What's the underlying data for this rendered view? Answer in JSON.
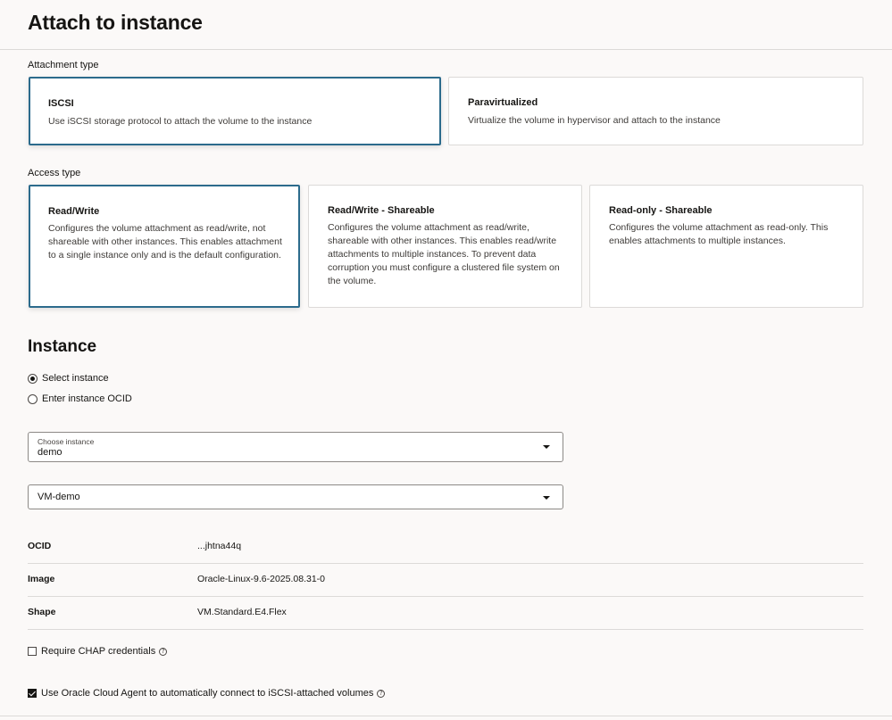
{
  "page": {
    "title": "Attach to instance"
  },
  "attachment_type": {
    "label": "Attachment type",
    "selected_index": 0,
    "options": [
      {
        "title": "ISCSI",
        "description": "Use iSCSI storage protocol to attach the volume to the instance"
      },
      {
        "title": "Paravirtualized",
        "description": "Virtualize the volume in hypervisor and attach to the instance"
      }
    ]
  },
  "access_type": {
    "label": "Access type",
    "selected_index": 0,
    "options": [
      {
        "title": "Read/Write",
        "description": "Configures the volume attachment as read/write, not shareable with other instances. This enables attachment to a single instance only and is the default configuration."
      },
      {
        "title": "Read/Write - Shareable",
        "description": "Configures the volume attachment as read/write, shareable with other instances. This enables read/write attachments to multiple instances. To prevent data corruption you must configure a clustered file system on the volume."
      },
      {
        "title": "Read-only - Shareable",
        "description": "Configures the volume attachment as read-only. This enables attachments to multiple instances."
      }
    ]
  },
  "instance": {
    "heading": "Instance",
    "radio_options": [
      {
        "label": "Select instance",
        "checked": true
      },
      {
        "label": "Enter instance OCID",
        "checked": false
      }
    ],
    "compartment_select": {
      "label": "Choose instance",
      "value": "demo"
    },
    "instance_select": {
      "value": "VM-demo"
    },
    "details": [
      {
        "key": "OCID",
        "value": "...jhtna44q"
      },
      {
        "key": "Image",
        "value": "Oracle-Linux-9.6-2025.08.31-0"
      },
      {
        "key": "Shape",
        "value": "VM.Standard.E4.Flex"
      }
    ]
  },
  "options": {
    "chap": {
      "label": "Require CHAP credentials",
      "checked": false,
      "help_icon": "question-circle-icon"
    },
    "cloud_agent": {
      "label": "Use Oracle Cloud Agent to automatically connect to iSCSI-attached volumes",
      "checked": true,
      "help_icon": "question-circle-icon"
    }
  },
  "colors": {
    "selected_border": "#2c6b8c",
    "background": "#fbf9f8",
    "card": "#ffffff",
    "divider": "#dcdad8",
    "text": "#161513"
  }
}
